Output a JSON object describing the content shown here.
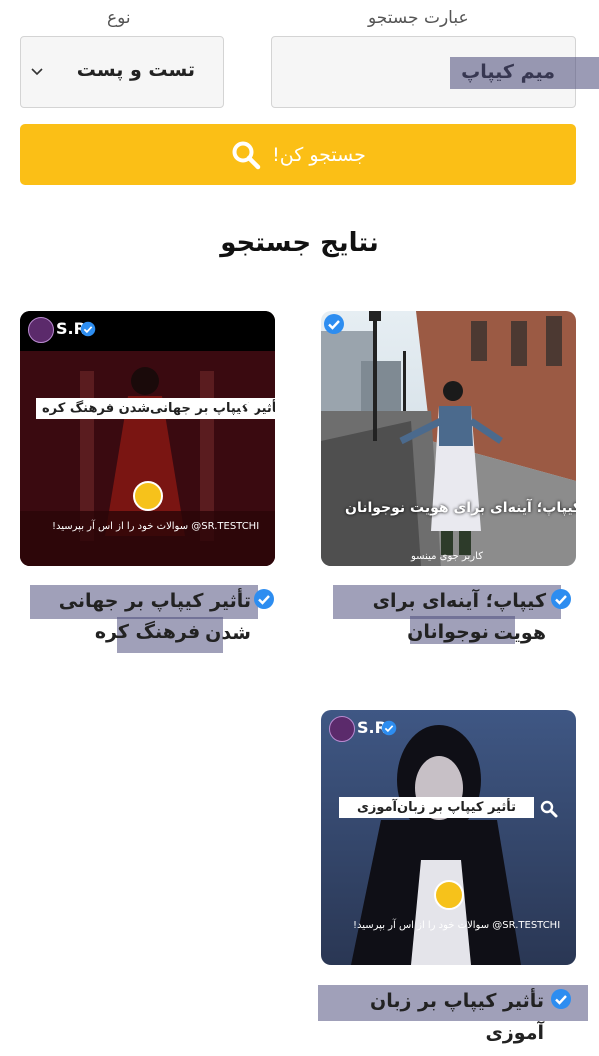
{
  "form": {
    "query_label": "عبارت جستجو",
    "query_value": "میم کیپاپ",
    "type_label": "نوع",
    "type_value": "تست و پست",
    "search_button": "جستجو کن!"
  },
  "results": {
    "title": "نتایج جستجو",
    "cards": [
      {
        "title": "کیپاپ؛ آینه‌ای برای هویت نوجوانان",
        "title_line1": "کیپاپ؛ آینه‌ای برای هویت",
        "title_line2": "نوجوانان",
        "image_caption": "کیپاپ؛ آینه‌ای برای هویت نوجوانان",
        "image_credit": "کاربر جوی مینسو"
      },
      {
        "title": "تأثیر کیپاپ بر جهانی شدن فرهنگ کره",
        "title_line1": "تأثیر کیپاپ بر جهانی شدن",
        "title_line2": "فرهنگ کره",
        "image_caption": "تأثیر کیپاپ بر جهانی‌شدن فرهنگ کره",
        "image_handle": "S.R",
        "image_question": "!سوالات خود را از اس آر بپرسید @SR.TESTCHI"
      },
      {
        "title": "تأثیر کیپاپ بر زبان آموزی",
        "image_caption": "تأثیر کیپاپ بر زبان‌آموزی",
        "image_handle": "S.R",
        "image_question": "!سوالات خود را از اس آر بپرسید @SR.TESTCHI"
      }
    ]
  }
}
